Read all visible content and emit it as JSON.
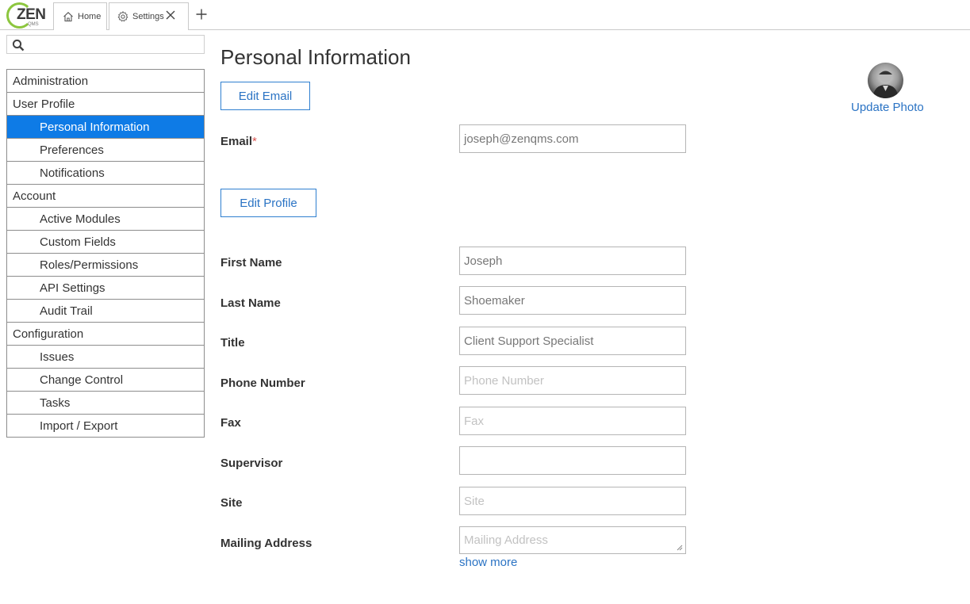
{
  "app": {
    "logo_text": "ZEN",
    "logo_sub": "QMS"
  },
  "tabs": [
    {
      "label": "Home",
      "icon": "home-icon"
    },
    {
      "label": "Settings",
      "icon": "gear-icon"
    }
  ],
  "sidebar": {
    "search_placeholder": "",
    "groups": [
      {
        "label": "Administration",
        "items": []
      },
      {
        "label": "User Profile",
        "items": [
          "Personal Information",
          "Preferences",
          "Notifications"
        ]
      },
      {
        "label": "Account",
        "items": [
          "Active Modules",
          "Custom Fields",
          "Roles/Permissions",
          "API Settings",
          "Audit Trail"
        ]
      },
      {
        "label": "Configuration",
        "items": [
          "Issues",
          "Change Control",
          "Tasks",
          "Import / Export"
        ]
      }
    ],
    "active_item": "Personal Information"
  },
  "main": {
    "title": "Personal Information",
    "edit_email_label": "Edit Email",
    "edit_profile_label": "Edit Profile",
    "update_photo_label": "Update Photo",
    "show_more_label": "show more",
    "email": {
      "label": "Email",
      "required_mark": "*",
      "value": "joseph@zenqms.com"
    },
    "fields": [
      {
        "label": "First Name",
        "value": "Joseph",
        "placeholder": ""
      },
      {
        "label": "Last Name",
        "value": "Shoemaker",
        "placeholder": ""
      },
      {
        "label": "Title",
        "value": "Client Support Specialist",
        "placeholder": ""
      },
      {
        "label": "Phone Number",
        "value": "",
        "placeholder": "Phone Number"
      },
      {
        "label": "Fax",
        "value": "",
        "placeholder": "Fax"
      },
      {
        "label": "Supervisor",
        "value": "",
        "placeholder": ""
      },
      {
        "label": "Site",
        "value": "",
        "placeholder": "Site"
      },
      {
        "label": "Mailing Address",
        "value": "",
        "placeholder": "Mailing Address"
      }
    ]
  },
  "colors": {
    "accent": "#0e7be6",
    "link": "#2a73c4",
    "logo_green": "#8cc63e",
    "required": "#d9534f"
  }
}
